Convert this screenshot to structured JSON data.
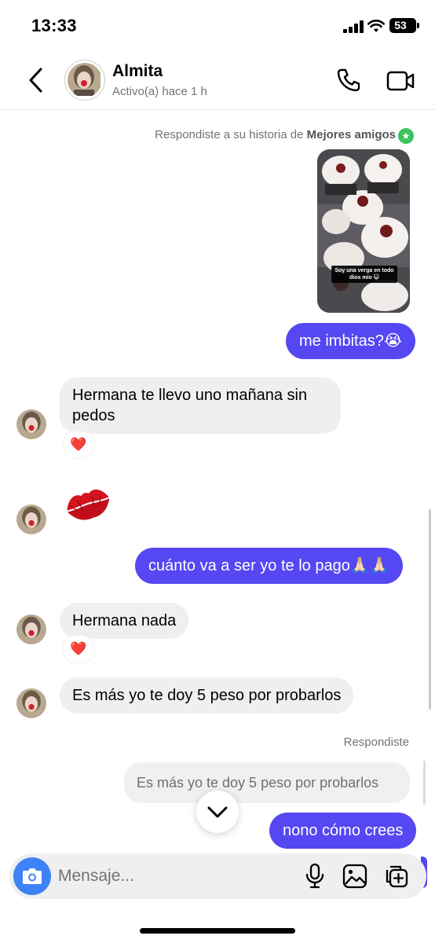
{
  "status_bar": {
    "time": "13:33",
    "battery": "53"
  },
  "header": {
    "contact_name": "Almita",
    "contact_status": "Activo(a) hace 1 h",
    "icons": {
      "back": "chevron-left-icon",
      "call": "phone-icon",
      "video": "video-camera-icon"
    }
  },
  "conversation": {
    "story_note_prefix": "Respondiste a su historia de",
    "story_note_highlight": "Mejores amigos",
    "story_caption": "Soy una verga en todo dios mío 😺",
    "messages": [
      {
        "direction": "outgoing",
        "text": "me imbitas?😭"
      },
      {
        "direction": "incoming",
        "line1": "Hermana te llevo uno mañana sin",
        "line2": "pedos",
        "reaction": "❤️"
      },
      {
        "direction": "incoming",
        "sticker": "kiss-lips"
      },
      {
        "direction": "outgoing",
        "text": "cuánto va a ser yo te lo pago🙏🏻🙏🏻"
      },
      {
        "direction": "incoming",
        "text": "Hermana nada",
        "reaction": "❤️"
      },
      {
        "direction": "incoming",
        "text": "Es más yo te doy 5 peso por probarlos"
      },
      {
        "direction": "outgoing",
        "replied_label": "Respondiste",
        "quoted_text": "Es más yo te doy 5 peso por probarlos",
        "text": "nono cómo crees"
      }
    ]
  },
  "composer": {
    "placeholder": "Mensaje...",
    "icons": [
      "camera-icon",
      "microphone-icon",
      "image-icon",
      "sticker-icon"
    ]
  },
  "colors": {
    "outgoing_bubble": "#5547f2",
    "incoming_bubble": "#efefef",
    "camera_button": "#3e82f7",
    "best_friends_badge": "#3dc35b"
  }
}
